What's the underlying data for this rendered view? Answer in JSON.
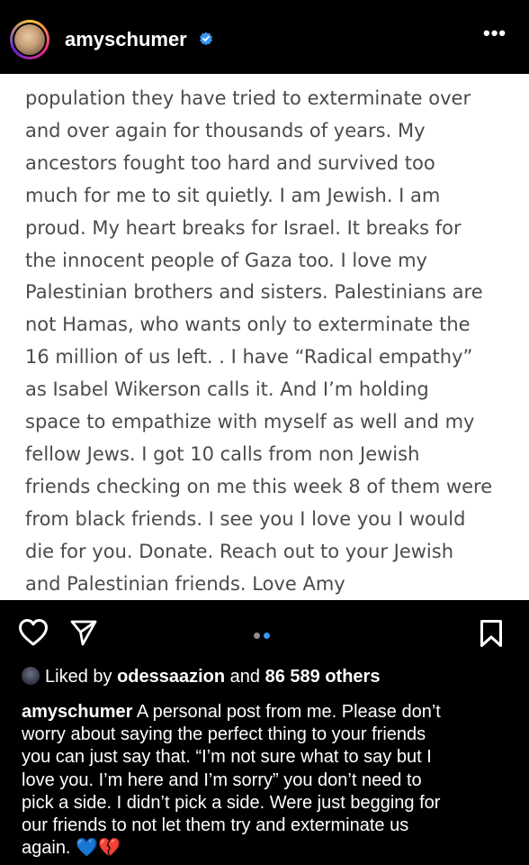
{
  "header": {
    "username": "amyschumer",
    "verified_icon": "verified-badge-icon",
    "more_label": "•••"
  },
  "post_text": {
    "lines": [
      "population they have tried to exterminate over",
      "and over again for thousands of years. My",
      "ancestors fought too hard and survived too",
      "much for me to sit quietly. I am Jewish. I am",
      "proud. My heart breaks for Israel. It breaks for",
      "the innocent people of Gaza too. I love my",
      "Palestinian brothers and sisters. Palestinians are",
      "not Hamas, who wants only to exterminate the",
      "16 million of us left. . I have “Radical empathy”",
      "as Isabel Wikerson calls it. And I’m holding",
      "space to empathize with myself as well and my",
      "fellow Jews. I got 10 calls from non Jewish",
      "friends checking on me this week 8 of them were",
      "from black friends. I see you I love you I would",
      "die for you. Donate. Reach out to your Jewish",
      "and Palestinian friends. Love Amy"
    ]
  },
  "actions": {
    "like_icon": "heart-icon",
    "share_icon": "send-icon",
    "save_icon": "bookmark-icon",
    "carousel_active_index": 2,
    "carousel_count": 2,
    "active_dot_color": "#3897f0",
    "inactive_dot_color": "#8e8e8e"
  },
  "likes": {
    "prefix": "Liked by ",
    "user": "odessaazion",
    "middle": " and ",
    "count": "86 589 others"
  },
  "caption": {
    "username": "amyschumer",
    "first_line_rest": " A personal post from me. Please don’t",
    "lines": [
      "worry about saying the perfect thing to your friends",
      "you can just say that. “I’m not sure what to say but I",
      "love you. I’m here and I’m sorry” you don’t need to",
      "pick a side. I didn’t pick a side. Were just begging for",
      "our friends to not let them try and exterminate us"
    ],
    "last_line": "again. 💙💔"
  }
}
